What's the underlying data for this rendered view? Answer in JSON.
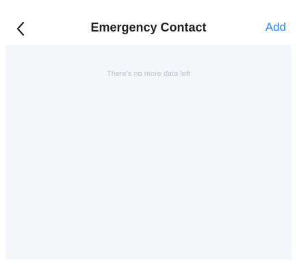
{
  "header": {
    "title": "Emergency Contact",
    "add_label": "Add",
    "back_icon": "chevron-left-icon"
  },
  "main": {
    "empty_message": "There's no more data left"
  },
  "colors": {
    "accent": "#2f86ea",
    "title": "#1f1f1f",
    "content_background": "#f3f6fb",
    "muted_text": "#bfc3c9"
  }
}
